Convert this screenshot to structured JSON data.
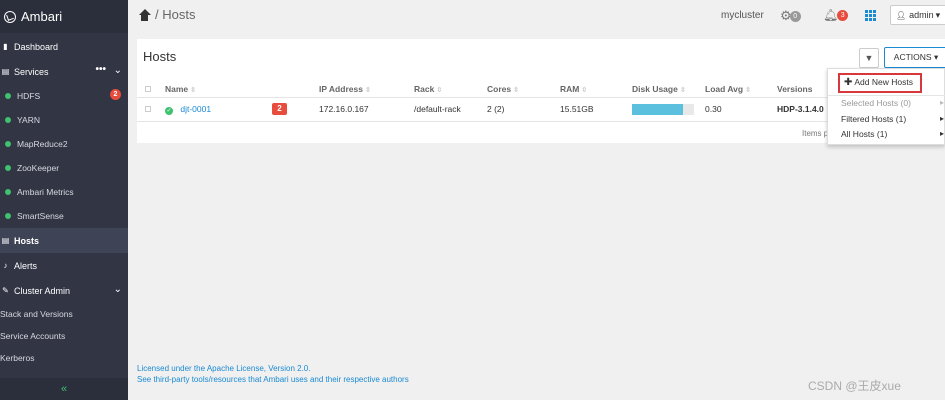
{
  "app": {
    "brand": "Ambari"
  },
  "sidebar": {
    "dashboard": "Dashboard",
    "services": "Services",
    "service_items": [
      {
        "label": "HDFS",
        "alerts": "2"
      },
      {
        "label": "YARN"
      },
      {
        "label": "MapReduce2"
      },
      {
        "label": "ZooKeeper"
      },
      {
        "label": "Ambari Metrics"
      },
      {
        "label": "SmartSense"
      }
    ],
    "hosts": "Hosts",
    "alerts": "Alerts",
    "cluster_admin": "Cluster Admin",
    "admin_items": [
      "Stack and Versions",
      "Service Accounts",
      "Kerberos"
    ],
    "collapse": "«"
  },
  "header": {
    "breadcrumb": "/ Hosts",
    "cluster": "mycluster",
    "ops_count": "0",
    "alerts_count": "3",
    "user": "admin"
  },
  "panel": {
    "title": "Hosts",
    "actions_label": "ACTIONS",
    "columns": [
      "Name",
      "IP Address",
      "Rack",
      "Cores",
      "RAM",
      "Disk Usage",
      "Load Avg",
      "Versions"
    ],
    "rows": [
      {
        "name": "djt-0001",
        "alerts": "2",
        "ip": "172.16.0.167",
        "rack": "/default-rack",
        "cores": "2 (2)",
        "ram": "15.51GB",
        "disk_usage_fraction": 0.82,
        "load_avg": "0.30",
        "version": "HDP-3.1.4.0"
      }
    ],
    "items_per_page": "Items p"
  },
  "dropdown": {
    "add_new_hosts": "Add New Hosts",
    "selected_hosts": "Selected Hosts (0)",
    "filtered_hosts": "Filtered Hosts (1)",
    "all_hosts": "All Hosts (1)"
  },
  "footer": {
    "license": "Licensed under the Apache License, Version 2.0.",
    "third_party": "See third-party tools/resources that Ambari uses and their respective authors"
  },
  "watermark": "CSDN @王皮xue",
  "colors": {
    "sidebar": "#323544",
    "accent": "#1a8ad3",
    "ok": "#3fc170",
    "alert": "#e74c3c",
    "disk": "#5bc0de"
  }
}
